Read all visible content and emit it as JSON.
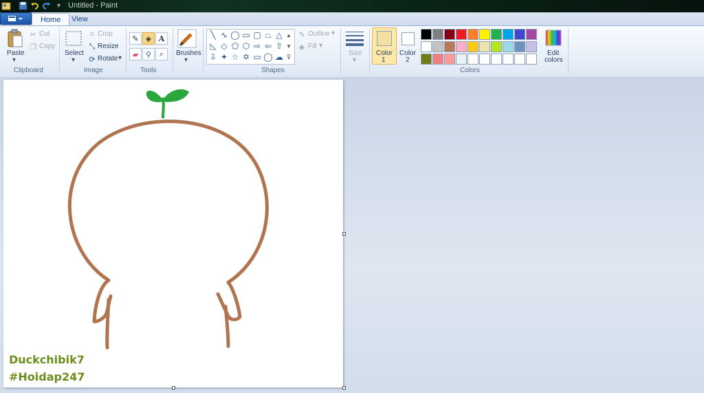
{
  "window": {
    "title": "Untitled - Paint"
  },
  "tabs": [
    {
      "label": "Home"
    },
    {
      "label": "View"
    }
  ],
  "clipboard": {
    "paste": "Paste",
    "cut": "Cut",
    "copy": "Copy",
    "group": "Clipboard"
  },
  "image": {
    "select": "Select",
    "crop": "Crop",
    "resize": "Resize",
    "rotate": "Rotate",
    "group": "Image"
  },
  "tools": {
    "group": "Tools"
  },
  "brushes": {
    "label": "Brushes"
  },
  "shapes": {
    "outline": "Outline",
    "fill": "Fill",
    "group": "Shapes"
  },
  "size": {
    "label": "Size"
  },
  "colors": {
    "color1_label": "Color",
    "color1_num": "1",
    "color2_label": "Color",
    "color2_num": "2",
    "edit_label": "Edit",
    "edit_label2": "colors",
    "group": "Colors",
    "color1_value": "#f5dfa2",
    "color2_value": "#ffffff",
    "palette": [
      [
        "#000000",
        "#7f7f7f",
        "#880015",
        "#ed1c24",
        "#ff7f27",
        "#fff200",
        "#22b14c",
        "#00a2e8",
        "#3f48cc",
        "#a349a4"
      ],
      [
        "#ffffff",
        "#c3c3c3",
        "#b97a57",
        "#ffaec9",
        "#ffc90e",
        "#efe4b0",
        "#b5e61d",
        "#99d9ea",
        "#7092be",
        "#c8bfe7"
      ],
      [
        "#6f7c15",
        "#f08080",
        "#ff9a9a",
        "#e8f4f4",
        "#ffffff",
        "#ffffff",
        "#ffffff",
        "#ffffff",
        "#ffffff",
        "#ffffff"
      ]
    ]
  },
  "drawing": {
    "stroke_color": "#b07550",
    "sprout_color": "#2aa63d"
  },
  "watermark": {
    "line1": "Duckchibik7",
    "line2": "#Hoidap247"
  }
}
